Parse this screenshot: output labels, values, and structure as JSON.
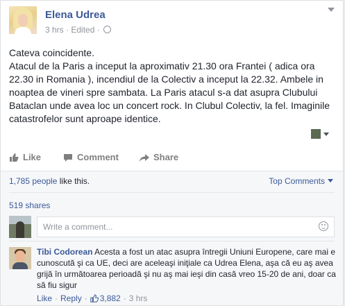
{
  "post": {
    "author": "Elena Udrea",
    "time": "3 hrs",
    "edited": "Edited",
    "meta_separator": "·",
    "privacy_icon": "globe-icon",
    "paragraphs": [
      "Cateva coincidente.",
      "Atacul de la Paris a inceput la aproximativ 21.30 ora Frantei ( adica ora 22.30 in Romania ), incendiul de la Colectiv a inceput la 22.32. Ambele in noaptea de vineri spre sambata. La Paris atacul s-a dat asupra Clubului Bataclan unde avea loc un concert rock. In Clubul Colectiv, la fel. Imaginile catastrofelor sunt aproape identice."
    ]
  },
  "actions": {
    "like": "Like",
    "comment": "Comment",
    "share": "Share"
  },
  "stats": {
    "likes_count": "1,785 people",
    "likes_suffix": " like this.",
    "top_comments": "Top Comments",
    "shares": "519 shares"
  },
  "composer": {
    "placeholder": "Write a comment..."
  },
  "comment": {
    "author": "Tibi Codorean",
    "text": "Acesta a fost un atac asupra întregii Uniuni Europene, care mai e cunoscută şi ca UE, deci are aceleaşi iniţiale ca Udrea Elena, aşa că eu aş avea grijă în următoarea perioadă şi nu aş mai ieşi din casă vreo 15-20 de ani, doar ca să fiu sigur",
    "like": "Like",
    "reply": "Reply",
    "likes": "3,882",
    "time": "3 hrs",
    "separator": "·"
  },
  "colors": {
    "link": "#3b5998",
    "meta": "#90949c",
    "action": "#7f7f7f"
  }
}
